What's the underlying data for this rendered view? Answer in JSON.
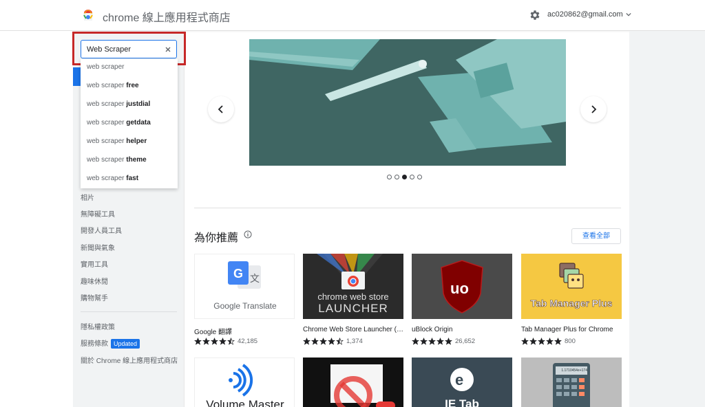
{
  "header": {
    "store_title": "chrome 線上應用程式商店",
    "account": "ac020862@gmail.com"
  },
  "search": {
    "value": "Web Scraper",
    "placeholder": ""
  },
  "suggestions": [
    {
      "prefix": "web scraper",
      "suffix": ""
    },
    {
      "prefix": "web scraper ",
      "suffix": "free"
    },
    {
      "prefix": "web scraper ",
      "suffix": "justdial"
    },
    {
      "prefix": "web scraper ",
      "suffix": "getdata"
    },
    {
      "prefix": "web scraper ",
      "suffix": "helper"
    },
    {
      "prefix": "web scraper ",
      "suffix": "theme"
    },
    {
      "prefix": "web scraper ",
      "suffix": "fast"
    }
  ],
  "categories": [
    "相片",
    "無障礙工具",
    "開發人員工具",
    "新聞與氣象",
    "實用工具",
    "趣味休閒",
    "購物幫手"
  ],
  "footer_links": {
    "privacy": "隱私權政策",
    "terms": "服務條款",
    "terms_badge": "Updated",
    "about": "關於 Chrome 線上應用程式商店"
  },
  "carousel": {
    "active_index": 2,
    "count": 5
  },
  "recommended": {
    "title": "為你推薦",
    "view_all": "查看全部",
    "items": [
      {
        "name": "Google 翻譯",
        "rating": 4.5,
        "count": "42,185",
        "thumb_text": "Google Translate"
      },
      {
        "name": "Chrome Web Store Launcher (…",
        "rating": 4.5,
        "count": "1,374",
        "thumb_text_1": "chrome web store",
        "thumb_text_2": "LAUNCHER"
      },
      {
        "name": "uBlock Origin",
        "rating": 5,
        "count": "26,652"
      },
      {
        "name": "Tab Manager Plus for Chrome",
        "rating": 5,
        "count": "800",
        "thumb_text": "Tab Manager Plus"
      }
    ],
    "row2": [
      {
        "thumb_text": "Volume Master"
      },
      {
        "thumb_text": ""
      },
      {
        "thumb_text": "IE Tab"
      },
      {
        "thumb_text": "1.1710454e+174"
      }
    ]
  },
  "colors": {
    "accent": "#1a73e8",
    "highlight": "#c62828",
    "banner": "#3f6663",
    "star": "#202124"
  }
}
